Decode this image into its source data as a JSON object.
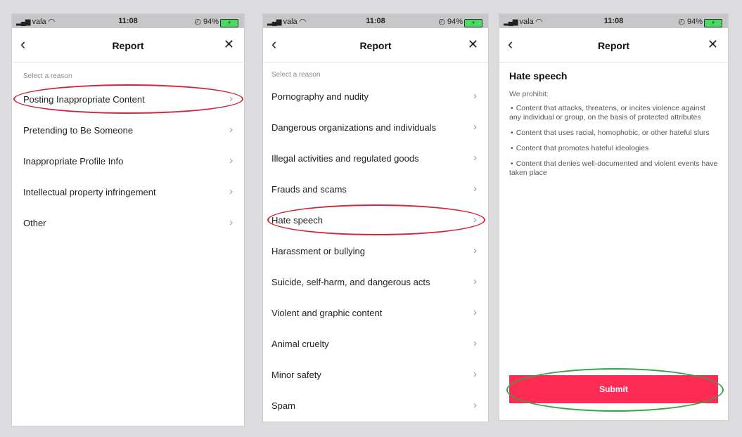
{
  "status_bar": {
    "carrier": "vala",
    "time": "11:08",
    "battery": "94%"
  },
  "nav": {
    "back_icon": "chevron-left-icon",
    "title": "Report",
    "close_icon": "close-icon"
  },
  "screen1": {
    "hint": "Select a reason",
    "reasons": [
      "Posting Inappropriate Content",
      "Pretending to Be Someone",
      "Inappropriate Profile Info",
      "Intellectual property infringement",
      "Other"
    ]
  },
  "screen2": {
    "hint": "Select a reason",
    "reasons": [
      "Pornography and nudity",
      "Dangerous organizations and individuals",
      "Illegal activities and regulated goods",
      "Frauds and scams",
      "Hate speech",
      "Harassment or bullying",
      "Suicide, self-harm, and dangerous acts",
      "Violent and graphic content",
      "Animal cruelty",
      "Minor safety",
      "Spam"
    ]
  },
  "screen3": {
    "title": "Hate speech",
    "intro": "We prohibit:",
    "bullets": [
      "Content that attacks, threatens, or incites violence against any individual or group, on the basis of protected attributes",
      "Content that uses racial, homophobic, or other hateful slurs",
      "Content that promotes hateful ideologies",
      "Content that denies well-documented and violent events have taken place"
    ],
    "submit_label": "Submit"
  },
  "colors": {
    "accent": "#fe2c55",
    "highlight_red": "#d0273a",
    "highlight_green": "#35a24a"
  }
}
